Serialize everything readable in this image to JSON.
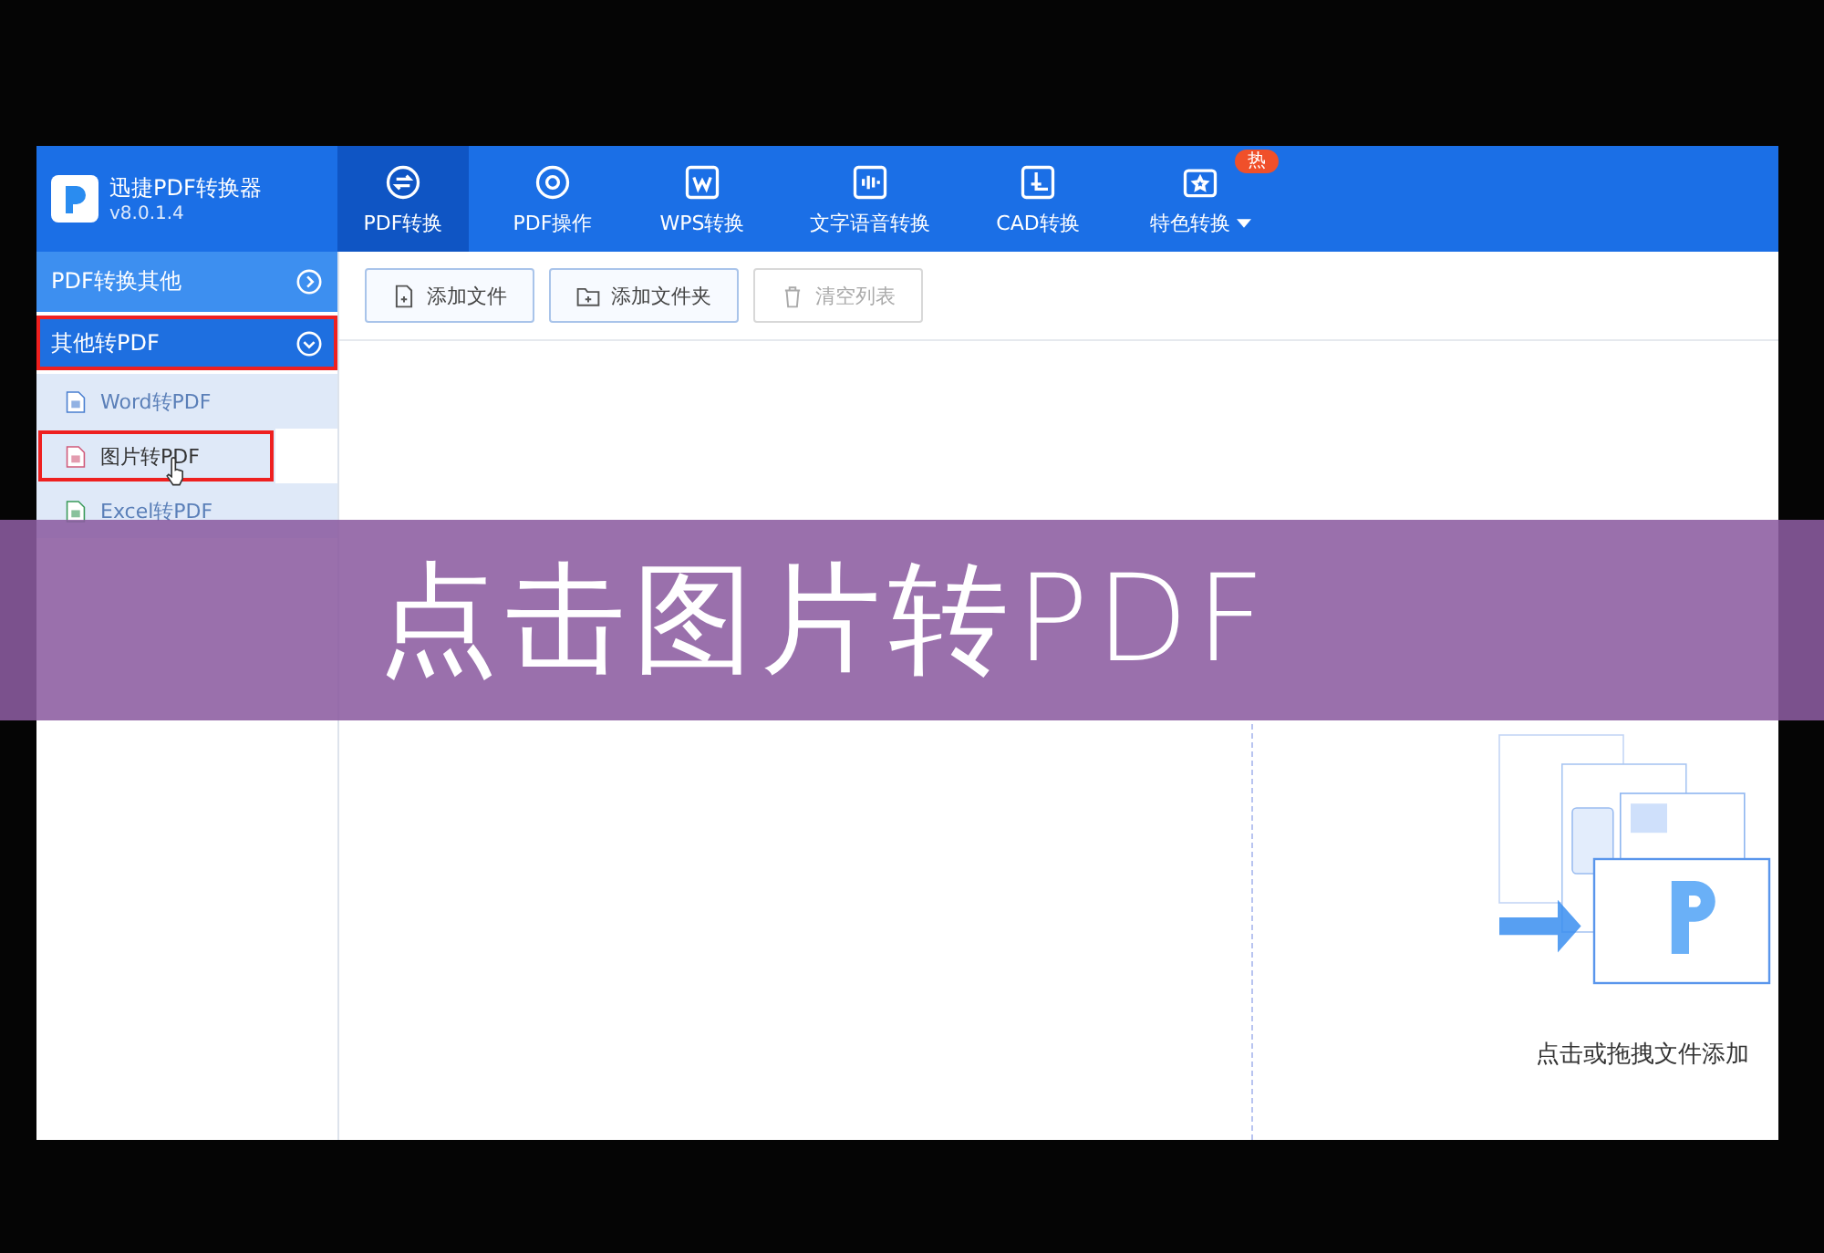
{
  "app": {
    "title": "迅捷PDF转换器",
    "version": "v8.0.1.4"
  },
  "tabs": [
    {
      "label": "PDF转换",
      "selected": true
    },
    {
      "label": "PDF操作",
      "selected": false
    },
    {
      "label": "WPS转换",
      "selected": false
    },
    {
      "label": "文字语音转换",
      "selected": false
    },
    {
      "label": "CAD转换",
      "selected": false
    },
    {
      "label": "特色转换",
      "selected": false,
      "badge": "热",
      "dropdown": true
    }
  ],
  "sidebar": {
    "groups": [
      {
        "label": "PDF转换其他",
        "expanded": false,
        "highlighted": false
      },
      {
        "label": "其他转PDF",
        "expanded": true,
        "highlighted": true,
        "items": [
          {
            "label": "Word转PDF",
            "kind": "word",
            "selected": false,
            "highlighted": false
          },
          {
            "label": "图片转PDF",
            "kind": "image",
            "selected": true,
            "highlighted": true
          },
          {
            "label": "Excel转PDF",
            "kind": "excel",
            "selected": false,
            "highlighted": false
          }
        ]
      }
    ]
  },
  "toolbar": [
    {
      "label": "添加文件",
      "disabled": false
    },
    {
      "label": "添加文件夹",
      "disabled": false
    },
    {
      "label": "清空列表",
      "disabled": true
    }
  ],
  "drop_zone": {
    "hint": "点击或拖拽文件添加"
  },
  "caption": "点击图片转PDF"
}
